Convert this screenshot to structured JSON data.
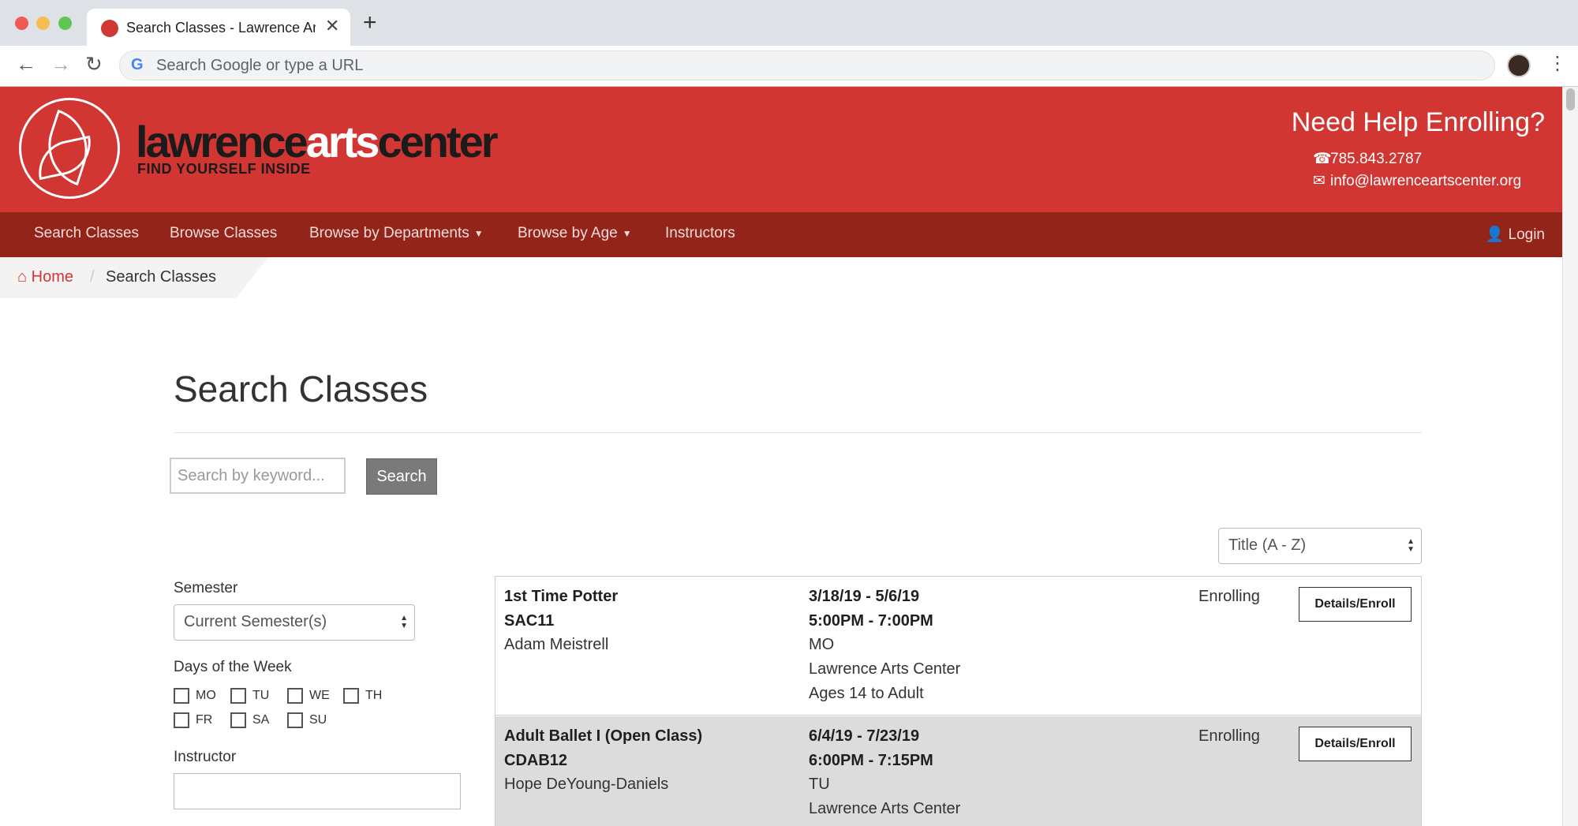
{
  "browser": {
    "tab_title": "Search Classes - Lawrence Arts Center",
    "omnibox_placeholder": "Search Google or type a URL"
  },
  "header": {
    "brand_dark1": "lawrence",
    "brand_light": "arts",
    "brand_dark2": "center",
    "tagline": "FIND YOURSELF INSIDE",
    "help_title": "Need Help Enrolling?",
    "phone": "785.843.2787",
    "email": "info@lawrenceartscenter.org"
  },
  "nav": {
    "items": [
      "Search Classes",
      "Browse Classes",
      "Browse by Departments",
      "Browse by Age",
      "Instructors"
    ],
    "login": "Login"
  },
  "breadcrumb": {
    "home": "Home",
    "current": "Search Classes"
  },
  "main": {
    "title": "Search Classes",
    "search_placeholder": "Search by keyword...",
    "search_button": "Search",
    "sort_value": "Title (A - Z)"
  },
  "filters": {
    "semester_label": "Semester",
    "semester_value": "Current Semester(s)",
    "days_label": "Days of the Week",
    "days": [
      "MO",
      "TU",
      "WE",
      "TH",
      "FR",
      "SA",
      "SU"
    ],
    "instructor_label": "Instructor"
  },
  "results": [
    {
      "title": "1st Time Potter",
      "code": "SAC11",
      "instructor": "Adam Meistrell",
      "dates": "3/18/19 - 5/6/19",
      "time": "5:00PM - 7:00PM",
      "days": "MO",
      "location": "Lawrence Arts Center",
      "ages": "Ages 14 to Adult",
      "status": "Enrolling",
      "button": "Details/Enroll"
    },
    {
      "title": "Adult Ballet I (Open Class)",
      "code": "CDAB12",
      "instructor": "Hope DeYoung-Daniels",
      "dates": "6/4/19 - 7/23/19",
      "time": "6:00PM - 7:15PM",
      "days": "TU",
      "location": "Lawrence Arts Center",
      "ages": "",
      "status": "Enrolling",
      "button": "Details/Enroll"
    }
  ],
  "colors": {
    "header_red": "#d13632",
    "nav_dark_red": "#922419"
  }
}
